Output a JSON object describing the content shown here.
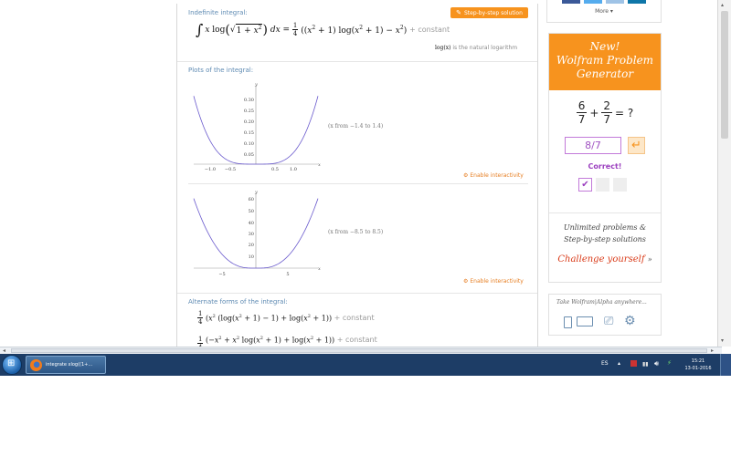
{
  "indefinite": {
    "title": "Indefinite integral:",
    "step_button": "Step-by-step solution",
    "constant": "+ constant",
    "log_note_var": "log(x)",
    "log_note_rest": " is the natural logarithm"
  },
  "plots": {
    "title": "Plots of the integral:",
    "plot1": {
      "y_ticks": [
        "0.30",
        "0.25",
        "0.20",
        "0.15",
        "0.10",
        "0.05"
      ],
      "x_ticks": [
        "−1.0",
        "−0.5",
        "0.5",
        "1.0"
      ],
      "range_note": "(x from −1.4 to 1.4)"
    },
    "plot2": {
      "y_ticks": [
        "60",
        "50",
        "40",
        "30",
        "20",
        "10"
      ],
      "x_ticks": [
        "−5",
        "5"
      ],
      "range_note": "(x from −8.5 to 8.5)"
    },
    "axis_y": "y",
    "axis_x": "x",
    "interactivity": "Enable interactivity"
  },
  "alternate": {
    "title": "Alternate forms of the integral:",
    "constant": "+ constant"
  },
  "sidebar": {
    "more": "More",
    "promo_title": [
      "New!",
      "Wolfram Problem",
      "Generator"
    ],
    "problem": {
      "a_num": "6",
      "a_den": "7",
      "b_num": "2",
      "b_den": "7",
      "eq": "= ?"
    },
    "answer": "8/7",
    "correct": "Correct!",
    "unlimited": [
      "Unlimited problems &",
      "Step-by-step solutions"
    ],
    "challenge": "Challenge yourself",
    "take_anywhere": "Take Wolfram|Alpha anywhere..."
  },
  "taskbar": {
    "task_label": "integrate xlog((1+...",
    "lang": "ES",
    "time": "15:21",
    "date": "13-01-2016"
  },
  "colors": {
    "accent": "#f7931e",
    "pod_title": "#5f8bb3",
    "curve": "#6a5acd",
    "taskbar": "#1d3d66"
  }
}
